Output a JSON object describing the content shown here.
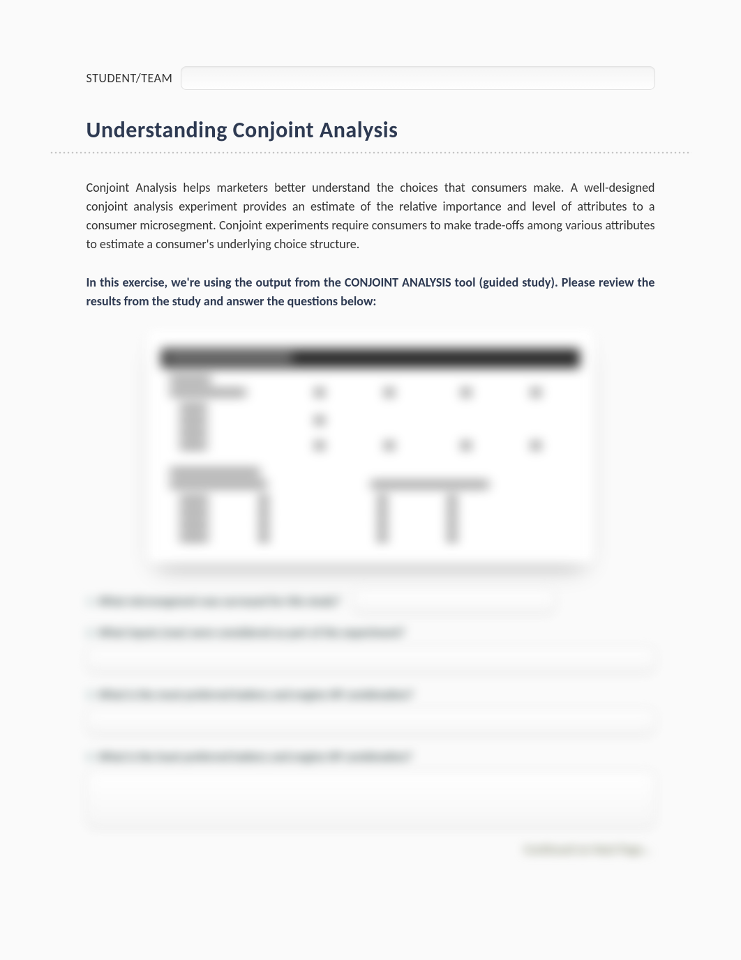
{
  "header": {
    "student_label": "STUDENT/TEAM"
  },
  "title": "Understanding Conjoint Analysis",
  "paragraph1": "Conjoint Analysis helps marketers better understand the choices that consumers make.  A well-designed conjoint analysis experiment provides an estimate of the relative importance and level of attributes to a consumer microsegment.   Conjoint experiments require consumers to make trade-offs among various attributes to estimate a consumer's underlying choice structure.",
  "paragraph2": "In this exercise, we're using the output from the CONJOINT ANALYSIS tool (guided study).  Please review the results from the study and answer the questions below:",
  "questions": {
    "q1": {
      "num": "1.",
      "text": "What microsegment was surveyed for this study?"
    },
    "q2": {
      "num": "2.",
      "text": "What inputs (raw) were considered as part of the experiment?"
    },
    "q3": {
      "num": "3.",
      "text": "What is the most preferred battery and engine HP combination?"
    },
    "q4": {
      "num": "4.",
      "text": "What is the least preferred battery and engine HP combination?"
    }
  },
  "footer": "Continued on Next Page…"
}
